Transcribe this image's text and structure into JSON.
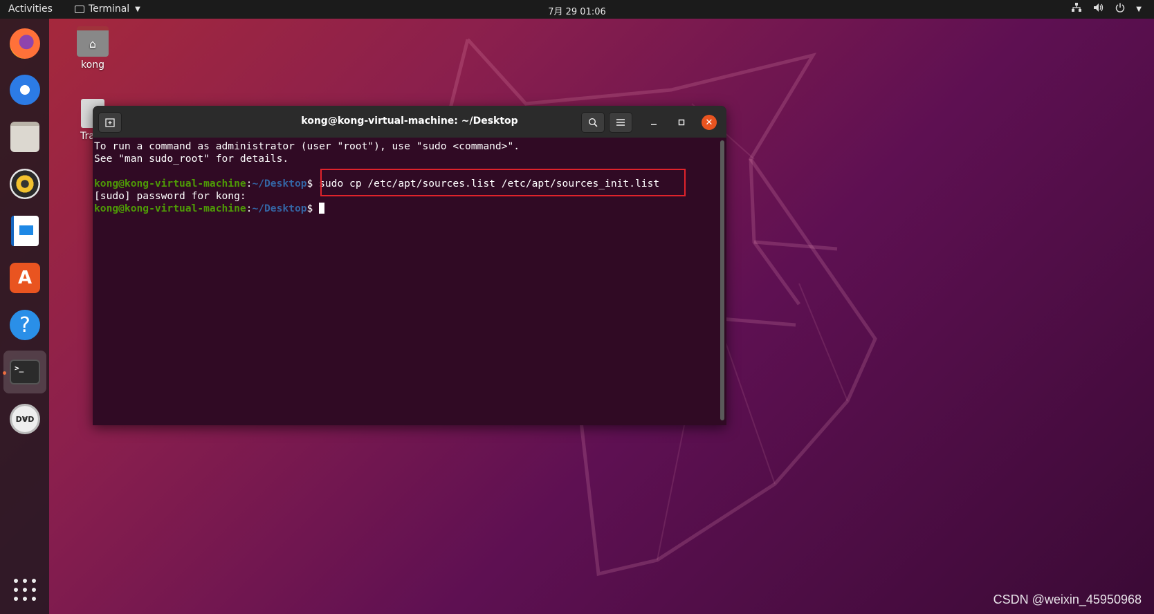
{
  "topbar": {
    "activities": "Activities",
    "app_name": "Terminal",
    "clock": "7月 29  01:06"
  },
  "desktop": {
    "home_label": "kong",
    "trash_label": "Tra"
  },
  "dock": {
    "items": [
      "firefox",
      "thunderbird",
      "files",
      "rhythmbox",
      "libreoffice-writer",
      "ubuntu-software",
      "help",
      "terminal",
      "dvd"
    ]
  },
  "terminal": {
    "title": "kong@kong-virtual-machine: ~/Desktop",
    "line1": "To run a command as administrator (user \"root\"), use \"sudo <command>\".",
    "line2": "See \"man sudo_root\" for details.",
    "prompt_user": "kong@kong-virtual-machine",
    "prompt_sep": ":",
    "prompt_path": "~/Desktop",
    "prompt_dollar": "$ ",
    "command": "sudo cp /etc/apt/sources.list /etc/apt/sources_init.list",
    "line_password": "[sudo] password for kong:"
  },
  "watermark": "CSDN @weixin_45950968",
  "colors": {
    "terminal_bg": "#300a24",
    "prompt_user": "#4e9a06",
    "prompt_path": "#3465a4",
    "highlight_box": "#e0232b",
    "accent": "#e95420"
  }
}
